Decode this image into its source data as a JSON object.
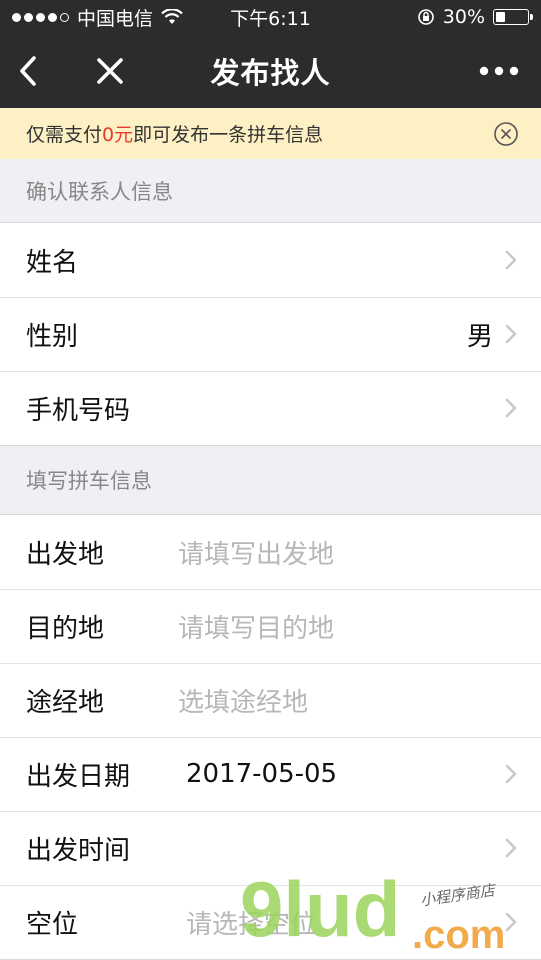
{
  "status_bar": {
    "carrier": "中国电信",
    "time": "下午6:11",
    "battery": "30%",
    "battery_level": 0.3
  },
  "navbar": {
    "title": "发布找人",
    "back_icon": "chevron-left-icon",
    "close_icon": "close-icon",
    "more_icon": "more-dots-icon"
  },
  "notice": {
    "prefix": "仅需支付",
    "price": "0元",
    "suffix": "即可发布一条拼车信息",
    "accent_color": "#e63c2f"
  },
  "contact_section": {
    "header": "确认联系人信息",
    "rows": [
      {
        "label": "姓名",
        "value": ""
      },
      {
        "label": "性别",
        "value": "男"
      },
      {
        "label": "手机号码",
        "value": ""
      }
    ]
  },
  "ride_section": {
    "header": "填写拼车信息",
    "rows": [
      {
        "label": "出发地",
        "placeholder": "请填写出发地"
      },
      {
        "label": "目的地",
        "placeholder": "请填写目的地"
      },
      {
        "label": "途经地",
        "placeholder": "选填途经地"
      },
      {
        "label": "出发日期",
        "value": "2017-05-05"
      },
      {
        "label": "出发时间",
        "value": ""
      },
      {
        "label": "空位",
        "placeholder": "请选择空位"
      }
    ]
  },
  "watermark": {
    "main": "9lud",
    "domain": ".com",
    "tagline": "小程序商店"
  }
}
